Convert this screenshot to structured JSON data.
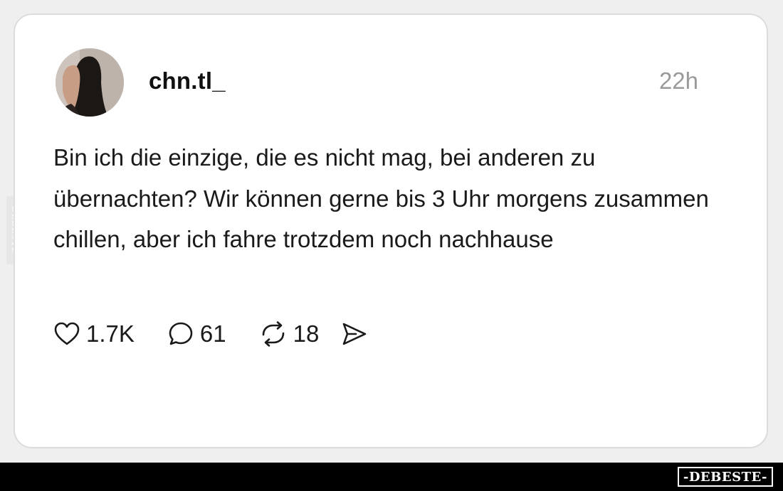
{
  "post": {
    "username": "chn.tl_",
    "timestamp": "22h",
    "text": "Bin ich die einzige, die es nicht mag, bei anderen zu übernachten? Wir können gerne bis 3 Uhr morgens zusammen chillen, aber ich fahre trotzdem noch nachhause"
  },
  "actions": {
    "likes": "1.7K",
    "comments": "61",
    "reposts": "18"
  },
  "watermark": {
    "side": "DEBESTE",
    "badge": "-DEBESTE-"
  },
  "icons": {
    "like": "heart-icon",
    "comment": "comment-bubble-icon",
    "repost": "repost-arrows-icon",
    "share": "send-icon"
  },
  "colors": {
    "background": "#efefef",
    "card": "#ffffff",
    "timestamp": "#9a9a9a",
    "text": "#1a1a1a",
    "footer": "#000000"
  }
}
